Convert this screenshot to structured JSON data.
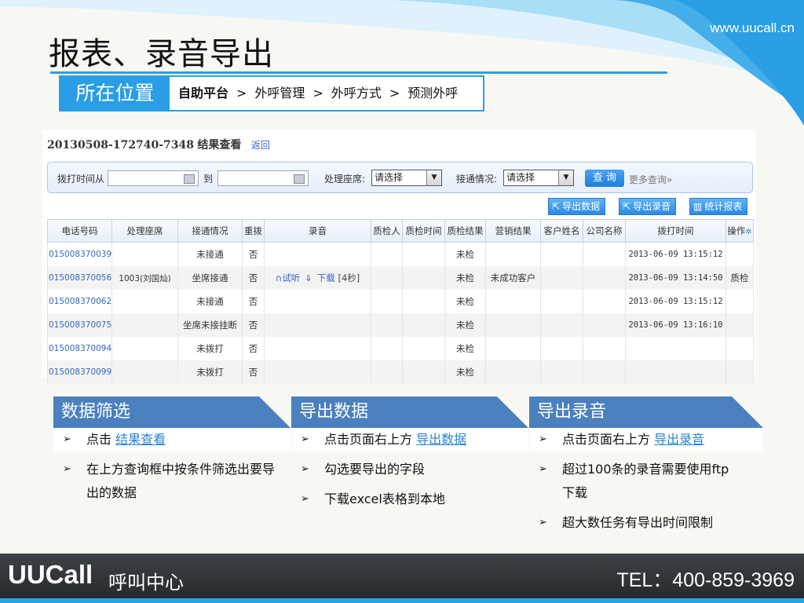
{
  "slide": {
    "website": "www.uucall.cn",
    "title": "报表、录音导出",
    "location_tag": "所在位置",
    "breadcrumb": [
      "自助平台",
      ">",
      "外呼管理",
      ">",
      "外呼方式",
      ">",
      "预测外呼"
    ]
  },
  "screenshot": {
    "task_id": "20130508-172740-7348",
    "heading": "结果查看",
    "back_link": "返回",
    "query": {
      "time_from_label": "拨打时间从",
      "time_to_label": "到",
      "agent_label": "处理座席:",
      "agent_value": "请选择",
      "connect_label": "接通情况:",
      "connect_value": "请选择",
      "search_button": "查 询",
      "more_query": "更多查询"
    },
    "toolbar": {
      "export_data": "导出数据",
      "export_recording": "导出录音",
      "stats_report": "统计报表"
    },
    "table": {
      "columns": [
        "电话号码",
        "处理座席",
        "接通情况",
        "重拨",
        "录音",
        "质检人",
        "质检时间",
        "质检结果",
        "营销结果",
        "客户姓名",
        "公司名称",
        "拨打时间",
        "操作"
      ],
      "rows": [
        {
          "phone": "015008370039",
          "agent": "",
          "status": "未接通",
          "redial": "否",
          "rec": false,
          "qc_result": "未检",
          "marketing": "",
          "call_time": "2013-06-09 13:15:12",
          "op": ""
        },
        {
          "phone": "015008370056",
          "agent": "1003(刘国灿)",
          "status": "坐席接通",
          "redial": "否",
          "rec": true,
          "qc_result": "未检",
          "marketing": "未成功客户",
          "call_time": "2013-06-09 13:14:50",
          "op": "质检"
        },
        {
          "phone": "015008370062",
          "agent": "",
          "status": "未接通",
          "redial": "否",
          "rec": false,
          "qc_result": "未检",
          "marketing": "",
          "call_time": "2013-06-09 13:15:12",
          "op": ""
        },
        {
          "phone": "015008370075",
          "agent": "",
          "status": "坐席未接挂断",
          "redial": "否",
          "rec": false,
          "qc_result": "未检",
          "marketing": "",
          "call_time": "2013-06-09 13:16:10",
          "op": ""
        },
        {
          "phone": "015008370094",
          "agent": "",
          "status": "未拨打",
          "redial": "否",
          "rec": false,
          "qc_result": "未检",
          "marketing": "",
          "call_time": "",
          "op": ""
        },
        {
          "phone": "015008370099",
          "agent": "",
          "status": "未拨打",
          "redial": "否",
          "rec": false,
          "qc_result": "未检",
          "marketing": "",
          "call_time": "",
          "op": ""
        }
      ],
      "recording": {
        "listen": "试听",
        "download": "下载",
        "duration": "[4秒]"
      }
    }
  },
  "panels": [
    {
      "title": "数据筛选",
      "items": [
        {
          "text": "点击 ",
          "link": "结果查看"
        },
        {
          "text": "在上方查询框中按条件筛选出要导出的数据",
          "link": ""
        }
      ]
    },
    {
      "title": "导出数据",
      "items": [
        {
          "text": "点击页面右上方 ",
          "link": "导出数据"
        },
        {
          "text": "勾选要导出的字段",
          "link": ""
        },
        {
          "text": "下载excel表格到本地",
          "link": ""
        }
      ]
    },
    {
      "title": "导出录音",
      "items": [
        {
          "text": "点击页面右上方 ",
          "link": "导出录音"
        },
        {
          "text": "超过100条的录音需要使用ftp下载",
          "link": ""
        },
        {
          "text": "超大数任务有导出时间限制",
          "link": ""
        }
      ]
    }
  ],
  "footer": {
    "brand": "UUCall",
    "brand_sub": "呼叫中心",
    "tel": "TEL：400-859-3969"
  },
  "colors": {
    "accent_blue": "#2a9ee4",
    "panel_header": "#4a80be",
    "link_blue": "#2a82d4",
    "footer_dark": "#2e3236"
  }
}
